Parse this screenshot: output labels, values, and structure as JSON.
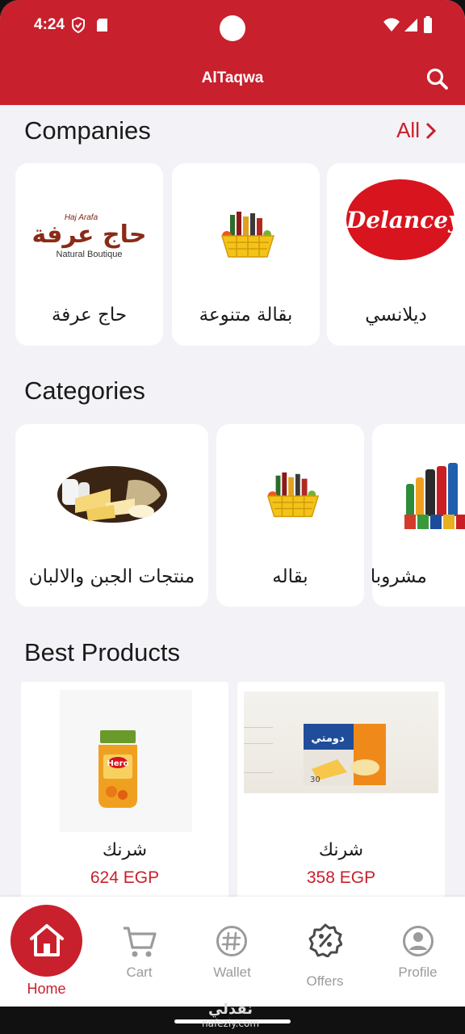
{
  "status_bar": {
    "time": "4:24"
  },
  "app_bar": {
    "title": "AlTaqwa"
  },
  "companies": {
    "title": "Companies",
    "all_label": "All",
    "items": [
      {
        "name": "حاج عرفة",
        "logo_text": "حاج عرفة",
        "logo_small": "Haj Arafa",
        "logo_sub": "Natural Boutique"
      },
      {
        "name": "بقالة متنوعة"
      },
      {
        "name": "ديلانسي",
        "logo_text": "Delancey"
      }
    ]
  },
  "categories": {
    "title": "Categories",
    "items": [
      {
        "name": "منتجات الجبن والالبان"
      },
      {
        "name": "بقاله"
      },
      {
        "name": "مشروبات"
      }
    ]
  },
  "best_products": {
    "title": "Best Products",
    "items": [
      {
        "name": "شرنك",
        "price": "624 EGP",
        "brand_text": "Hero"
      },
      {
        "name": "شرنك",
        "price": "358 EGP",
        "brand_text": "دومتي"
      }
    ]
  },
  "bottom_nav": {
    "items": [
      {
        "label": "Home",
        "icon": "home-icon",
        "active": true
      },
      {
        "label": "Cart",
        "icon": "cart-icon"
      },
      {
        "label": "Wallet",
        "icon": "hash-icon"
      },
      {
        "label": "Offers",
        "icon": "discount-badge-icon"
      },
      {
        "label": "Profile",
        "icon": "person-icon"
      }
    ]
  },
  "watermark": {
    "arabic": "نفذلي",
    "latin": "nafezly.com"
  },
  "colors": {
    "primary": "#c8202c",
    "background": "#f3f2f6",
    "inactive": "#9b9b9b"
  }
}
